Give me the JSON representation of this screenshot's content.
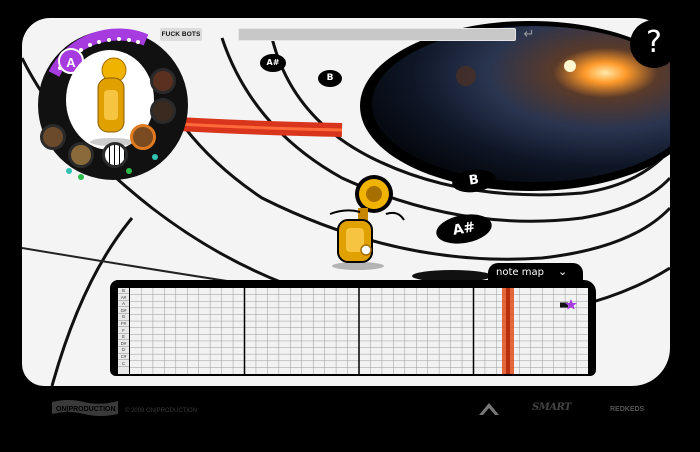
{
  "header": {
    "title_tag": "FUCK BOTS",
    "input_value": "",
    "enter_glyph": "↵",
    "help_label": "?"
  },
  "wheel": {
    "active_slot": "A",
    "colors": {
      "arc": "#a63be0",
      "accent": "#e07a1f",
      "green": "#2bbd4a",
      "teal": "#2ec4b6"
    },
    "instruments": [
      "tuba-icon",
      "violin-icon",
      "guitar-icon",
      "bass-icon",
      "piano-icon",
      "saxophone-icon",
      "drum-icon"
    ]
  },
  "notes": {
    "a_sharp_1": "A#",
    "b_1": "B",
    "b_2": "B",
    "a_sharp_2": "A#"
  },
  "note_map": {
    "title": "note map",
    "toggle": "⌄",
    "pitches": [
      "B",
      "A#",
      "A",
      "G#",
      "G",
      "F#",
      "F",
      "E",
      "D#",
      "D",
      "C#",
      "C"
    ]
  },
  "footer": {
    "logo": "ON|PRODUCTION",
    "copyright": "© 2008 ON|PRODUCTION",
    "smart": "SMART",
    "redkeds": "REDKEDS"
  }
}
